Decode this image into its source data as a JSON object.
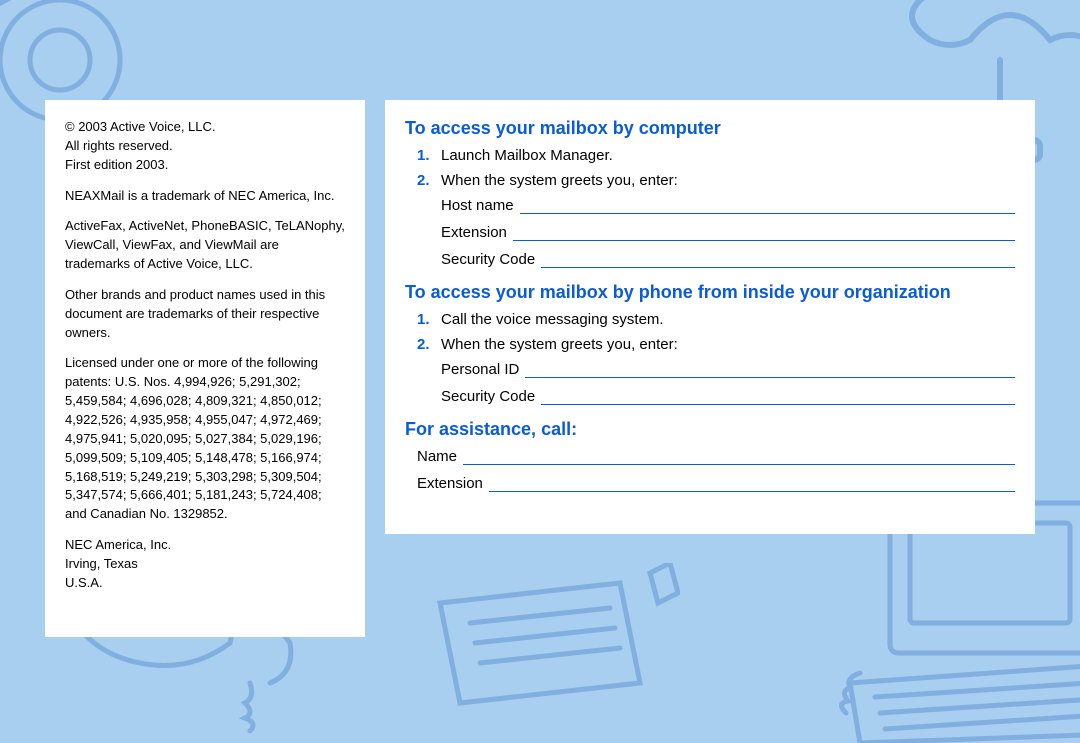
{
  "legal": {
    "copyright": "© 2003 Active Voice, LLC.",
    "rights": "All rights reserved.",
    "edition": "First edition 2003.",
    "trademark1": "NEAXMail is a trademark of NEC America, Inc.",
    "trademark2": "ActiveFax, ActiveNet, PhoneBASIC, TeLANophy, ViewCall, ViewFax, and ViewMail are trademarks of Active Voice, LLC.",
    "trademark3": "Other brands and product names used in this document are trademarks of their respective owners.",
    "patents": "Licensed under one or more of the following patents: U.S. Nos. 4,994,926; 5,291,302; 5,459,584; 4,696,028; 4,809,321; 4,850,012; 4,922,526; 4,935,958; 4,955,047; 4,972,469; 4,975,941; 5,020,095; 5,027,384; 5,029,196; 5,099,509; 5,109,405; 5,148,478; 5,166,974; 5,168,519; 5,249,219; 5,303,298; 5,309,504; 5,347,574; 5,666,401; 5,181,243; 5,724,408; and Canadian No. 1329852.",
    "company": "NEC America, Inc.",
    "city": "Irving, Texas",
    "country": "U.S.A."
  },
  "computer": {
    "title": "To access your mailbox by computer",
    "step1": "Launch Mailbox Manager.",
    "step2": "When the system greets you, enter:",
    "field1": "Host name",
    "field2": "Extension",
    "field3": "Security Code"
  },
  "phone": {
    "title": "To access your mailbox by phone from inside your organization",
    "step1": "Call the voice messaging system.",
    "step2": "When the system greets you, enter:",
    "field1": "Personal ID",
    "field2": "Security Code"
  },
  "assist": {
    "title": "For assistance, call:",
    "field1": "Name",
    "field2": "Extension"
  },
  "nums": {
    "one": "1.",
    "two": "2."
  }
}
